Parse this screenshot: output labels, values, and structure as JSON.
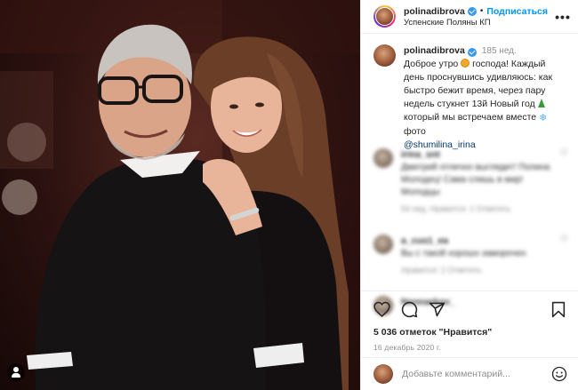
{
  "post": {
    "username": "polinadibrova",
    "follow_label": "Подписаться",
    "separator": "•",
    "location": "Успенские Поляны КП",
    "more_icon": "more-dots-icon"
  },
  "caption": {
    "username": "polinadibrova",
    "time": "185 нед.",
    "text_part1": "Доброе утро",
    "text_part2": "господа! Каждый день проснувшись удивляюсь: как быстро бежит время, через пару недель стукнет 13й Новый год",
    "text_part3": "который мы встречаем вместе",
    "text_part4": "фото",
    "mention": "@shumilina_irina"
  },
  "comments": [
    {
      "user": "irina_snt",
      "text": "Дмитрий отлично выглядит! Полина Молодец! Сама слишь в мир! Молодцы",
      "meta": "54 нед.   Нравится: 1   Ответить"
    },
    {
      "user": "a_cus1_ea",
      "text": "Вы с такой хорошо заморочен",
      "meta": "Нравится: 2   Ответить"
    },
    {
      "user": "Nonnarkov_",
      "text": "",
      "meta": ""
    }
  ],
  "actions": {
    "like_icon": "heart-icon",
    "comment_icon": "comment-icon",
    "share_icon": "share-icon",
    "save_icon": "bookmark-icon"
  },
  "likes": "5 036 отметок \"Нравится\"",
  "date": "16 декабрь 2020 г.",
  "add_comment": {
    "placeholder": "Добавьте комментарий...",
    "emoji_icon": "smile-icon"
  },
  "colors": {
    "accent": "#0095f6",
    "verified": "#3897f0",
    "muted": "#8e8e8e",
    "text": "#262626"
  }
}
